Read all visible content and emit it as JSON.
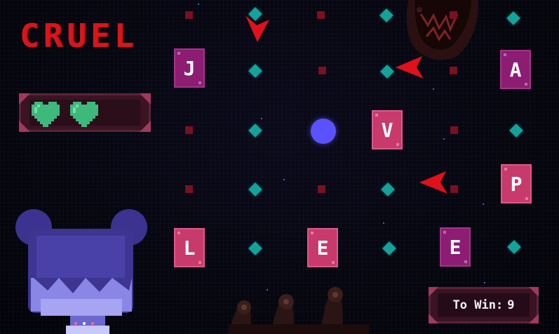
{
  "hud": {
    "difficulty": "CRUEL",
    "hearts": 2,
    "to_win_label": "To Win:",
    "to_win_value": "9"
  },
  "board": {
    "tiles": [
      {
        "letter": "J",
        "style": "purple"
      },
      {
        "letter": "A",
        "style": "purple"
      },
      {
        "letter": "V",
        "style": "pink"
      },
      {
        "letter": "P",
        "style": "pink"
      },
      {
        "letter": "L",
        "style": "pink"
      },
      {
        "letter": "E",
        "style": "pink"
      },
      {
        "letter": "E",
        "style": "purple"
      }
    ]
  },
  "colors": {
    "difficulty": "#d8161a",
    "player": "#5b52ff",
    "heart": "#3db97c",
    "arrow": "#e0101c",
    "tile_pink": "#c73a6b",
    "tile_purple": "#8c1d73"
  },
  "icons": [
    "heart-icon",
    "arrow-down-icon",
    "arrow-left-icon",
    "player-orb",
    "chomper-monster",
    "girl-portrait",
    "tentacle-creature"
  ]
}
